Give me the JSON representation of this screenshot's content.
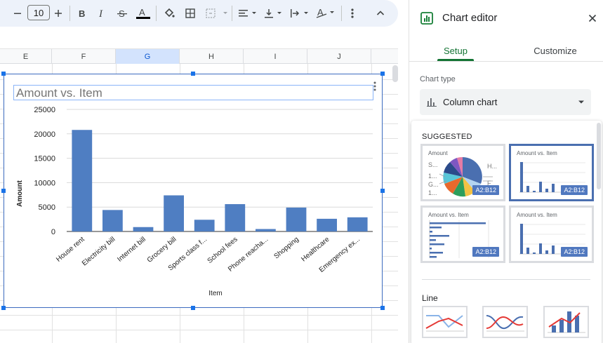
{
  "toolbar": {
    "font_size": "10",
    "items": [
      "decrease-font-size",
      "increase-font-size",
      "bold",
      "italic",
      "strikethrough",
      "text-color",
      "fill-color",
      "borders",
      "merge-cells",
      "horizontal-align",
      "vertical-align",
      "text-wrapping",
      "text-rotation",
      "more",
      "collapse"
    ]
  },
  "sheet": {
    "columns": [
      "E",
      "F",
      "G",
      "H",
      "I",
      "J"
    ],
    "selected_column": "G"
  },
  "chart": {
    "title": "Amount vs. Item",
    "accent_color": "#4f7ec2"
  },
  "chart_data": {
    "type": "bar",
    "title": "Amount vs. Item",
    "xlabel": "Item",
    "ylabel": "Amount",
    "ylim": [
      0,
      25000
    ],
    "yticks": [
      "0",
      "5000",
      "10000",
      "15000",
      "20000",
      "25000"
    ],
    "categories": [
      "House rent",
      "Electricity bill",
      "Internet bill",
      "Grocery bill",
      "Sports class f...",
      "School fees",
      "Phone reacha...",
      "Shopping",
      "Healthcare",
      "Emergency ex..."
    ],
    "values": [
      20800,
      4400,
      900,
      7400,
      2400,
      5600,
      500,
      4900,
      2600,
      2900
    ],
    "grid": true,
    "legend": "none"
  },
  "panel": {
    "title": "Chart editor",
    "tabs": [
      "Setup",
      "Customize"
    ],
    "active_tab": "Setup",
    "chart_type_label": "Chart type",
    "chart_type_value": "Column chart",
    "suggested_label": "SUGGESTED",
    "suggestions": [
      {
        "title": "Amount",
        "badge": "A2:B12",
        "kind": "pie",
        "labels": [
          "S...",
          "1...",
          "G...",
          "1...",
          "H...",
          "F"
        ]
      },
      {
        "title": "Amount vs. Item",
        "badge": "A2:B12",
        "kind": "column"
      },
      {
        "title": "Amount vs. Item",
        "badge": "A2:B12",
        "kind": "bar"
      },
      {
        "title": "Amount vs. Item",
        "badge": "A2:B12",
        "kind": "column"
      }
    ],
    "line_section_label": "Line"
  }
}
